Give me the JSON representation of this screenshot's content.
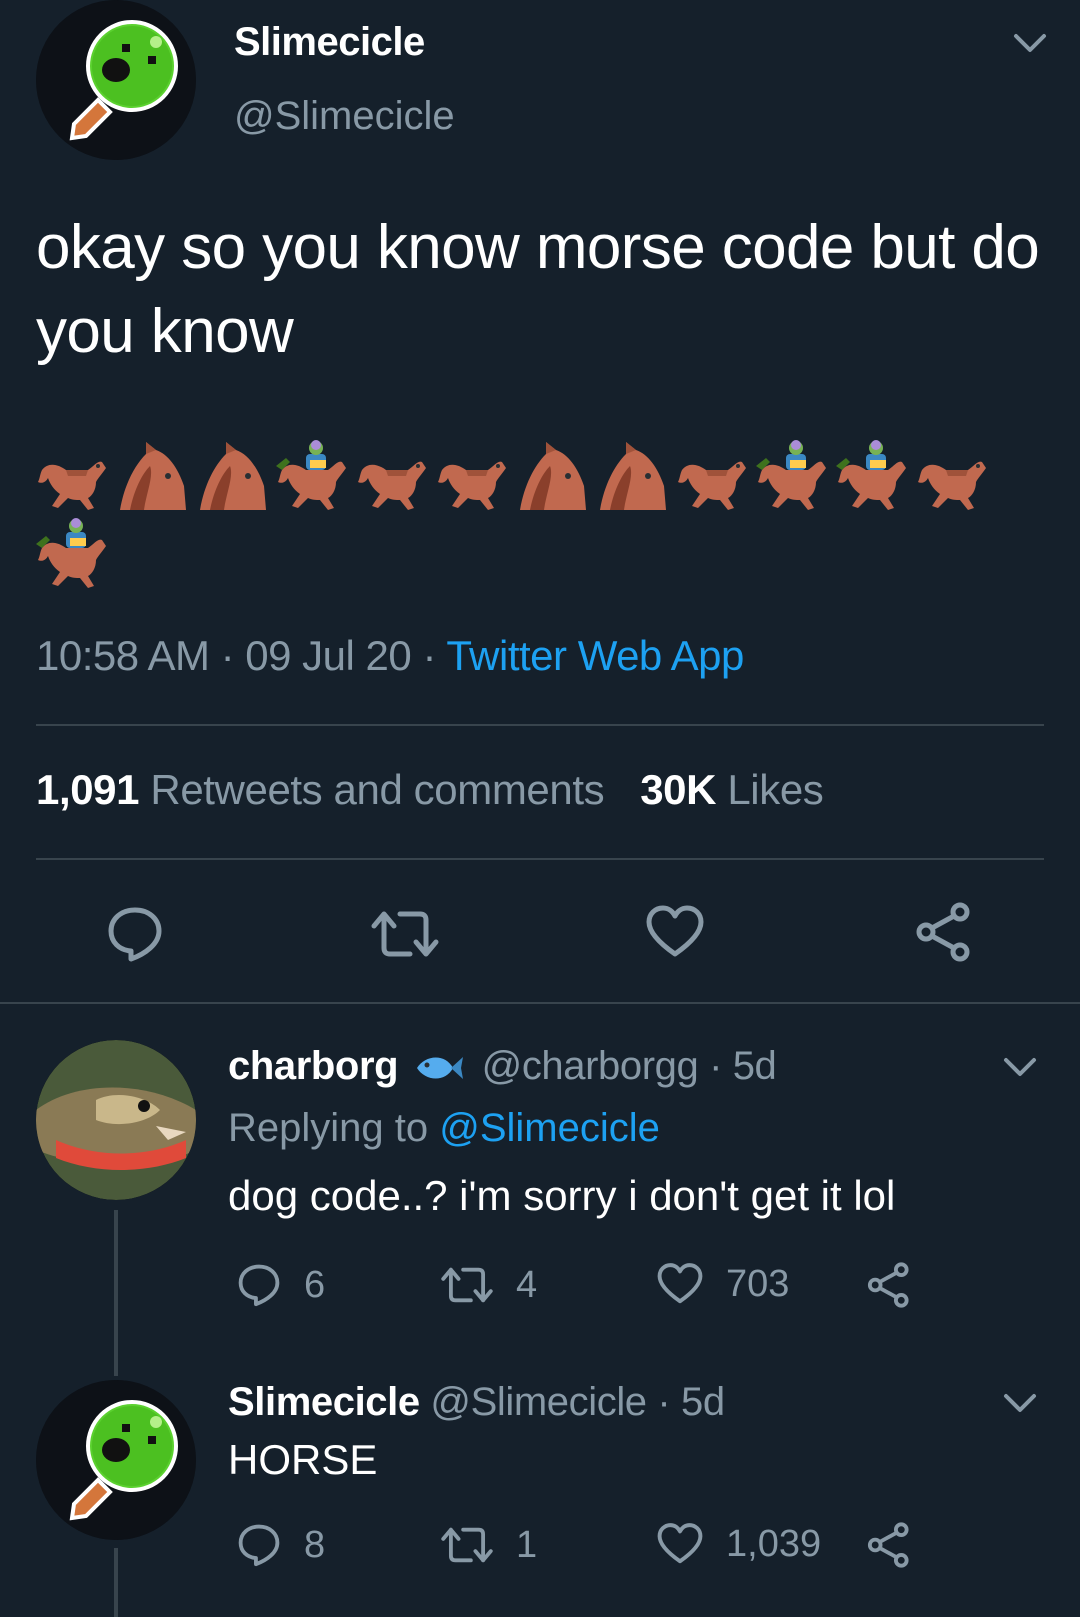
{
  "main_tweet": {
    "author_name": "Slimecicle",
    "author_handle": "@Slimecicle",
    "text": "okay so you know morse code but do you know",
    "emoji_sequence": [
      "horse",
      "horse-face",
      "horse-face",
      "horse-racing",
      "horse",
      "horse",
      "horse-face",
      "horse-face",
      "horse",
      "horse-racing",
      "horse-racing",
      "horse",
      "horse-racing"
    ],
    "time": "10:58 AM",
    "date": "09 Jul 20",
    "client": "Twitter Web App",
    "retweets_count": "1,091",
    "retweets_label": "Retweets and comments",
    "likes_count": "30K",
    "likes_label": "Likes",
    "actions": [
      "reply-icon",
      "retweet-icon",
      "like-icon",
      "share-icon"
    ]
  },
  "replies": [
    {
      "author_name": "charborg",
      "badge": "fish-emoji",
      "author_handle": "@charborgg",
      "age": "5d",
      "replying_prefix": "Replying to",
      "replying_to": "@Slimecicle",
      "text": "dog code..? i'm sorry i don't get it lol",
      "reply_count": "6",
      "retweet_count": "4",
      "like_count": "703"
    },
    {
      "author_name": "Slimecicle",
      "author_handle": "@Slimecicle",
      "age": "5d",
      "text": "HORSE",
      "reply_count": "8",
      "retweet_count": "1",
      "like_count": "1,039"
    }
  ],
  "colors": {
    "background": "#15202b",
    "secondary_text": "#8899a6",
    "link": "#1da1f2",
    "divider": "#38444d"
  }
}
